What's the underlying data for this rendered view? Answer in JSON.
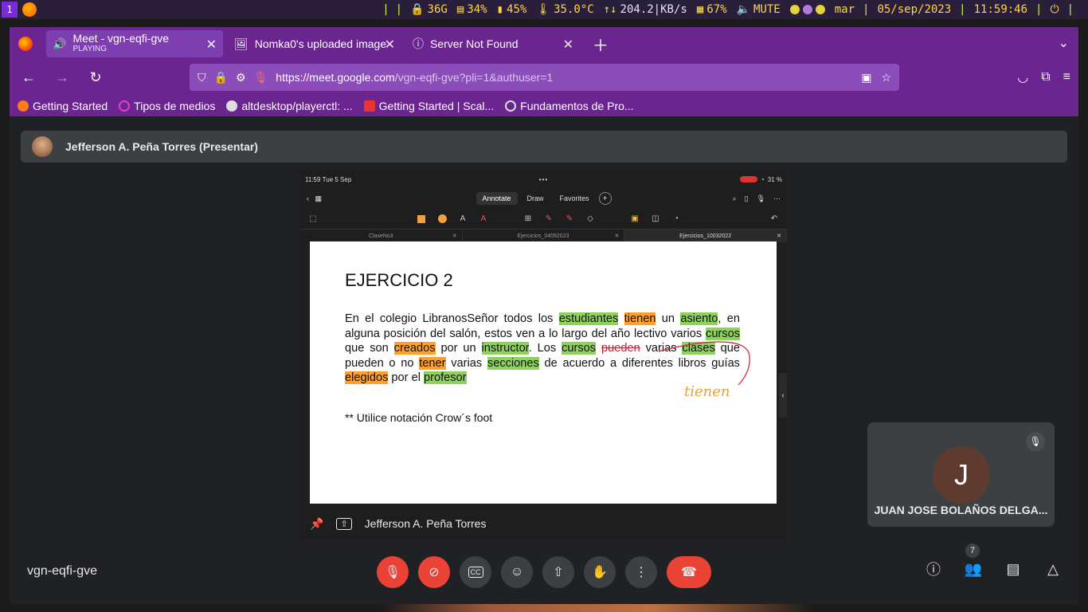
{
  "statusbar": {
    "workspace": "1",
    "storage": "36G",
    "cpu": "34%",
    "mem": "45%",
    "temp": "35.0°C",
    "net": "204.2|KB/s",
    "bright": "67%",
    "volume": "MUTE",
    "day": "mar",
    "date": "05/sep/2023",
    "time": "11:59:46"
  },
  "browser": {
    "tabs": [
      {
        "title": "Meet - vgn-eqfi-gve",
        "sub": "PLAYING"
      },
      {
        "title": "Nomka0's uploaded image"
      },
      {
        "title": "Server Not Found"
      }
    ],
    "url_host": "https://meet.google.com",
    "url_path": "/vgn-eqfi-gve?pli=1&authuser=1",
    "bookmarks": [
      "Getting Started",
      "Tipos de medios",
      "altdesktop/playerctl: ...",
      "Getting Started | Scal...",
      "Fundamentos de Pro..."
    ]
  },
  "meet": {
    "presenter_label": "Jefferson A. Peña Torres (Presentar)",
    "share_footer_name": "Jefferson A. Peña Torres",
    "meeting_code": "vgn-eqfi-gve",
    "participant_count": "7",
    "tile_initial": "J",
    "tile_name": "JUAN JOSE BOLAÑOS DELGA..."
  },
  "ipad": {
    "time": "11:59",
    "date": "Tue 5 Sep",
    "battery": "31 %",
    "tabs": [
      "Annotate",
      "Draw",
      "Favorites"
    ],
    "docs": [
      "ClaseNo3",
      "Ejercicios_04092023",
      "Ejercicios_10032022"
    ]
  },
  "document": {
    "title": "EJERCICIO 2",
    "p": {
      "t1": "En el colegio LibranosSeñor todos los ",
      "h1": "estudiantes",
      "t2": " ",
      "h2": "tienen",
      "t3": " un ",
      "h3": "asiento",
      "t4": ", en alguna posición del salón, estos ven a lo largo del año lectivo varios ",
      "h4": "cursos",
      "t5": " que son ",
      "h5": "creados",
      "t6": " por un ",
      "h6": "instructor",
      "t7": ". Los ",
      "h7": "cursos",
      "t8": " ",
      "s1": "pueden",
      "t9": " varias ",
      "h8": "clases",
      "t10": " que pueden o no ",
      "h9": "tener",
      "t11": " varias ",
      "h10": "secciones",
      "t12": " de acuerdo a diferentes libros guías ",
      "h11": "elegidos",
      "t13": " por el ",
      "h12": "profesor"
    },
    "note": "** Utilice notación Crow´s foot",
    "handwriting": "tienen"
  }
}
